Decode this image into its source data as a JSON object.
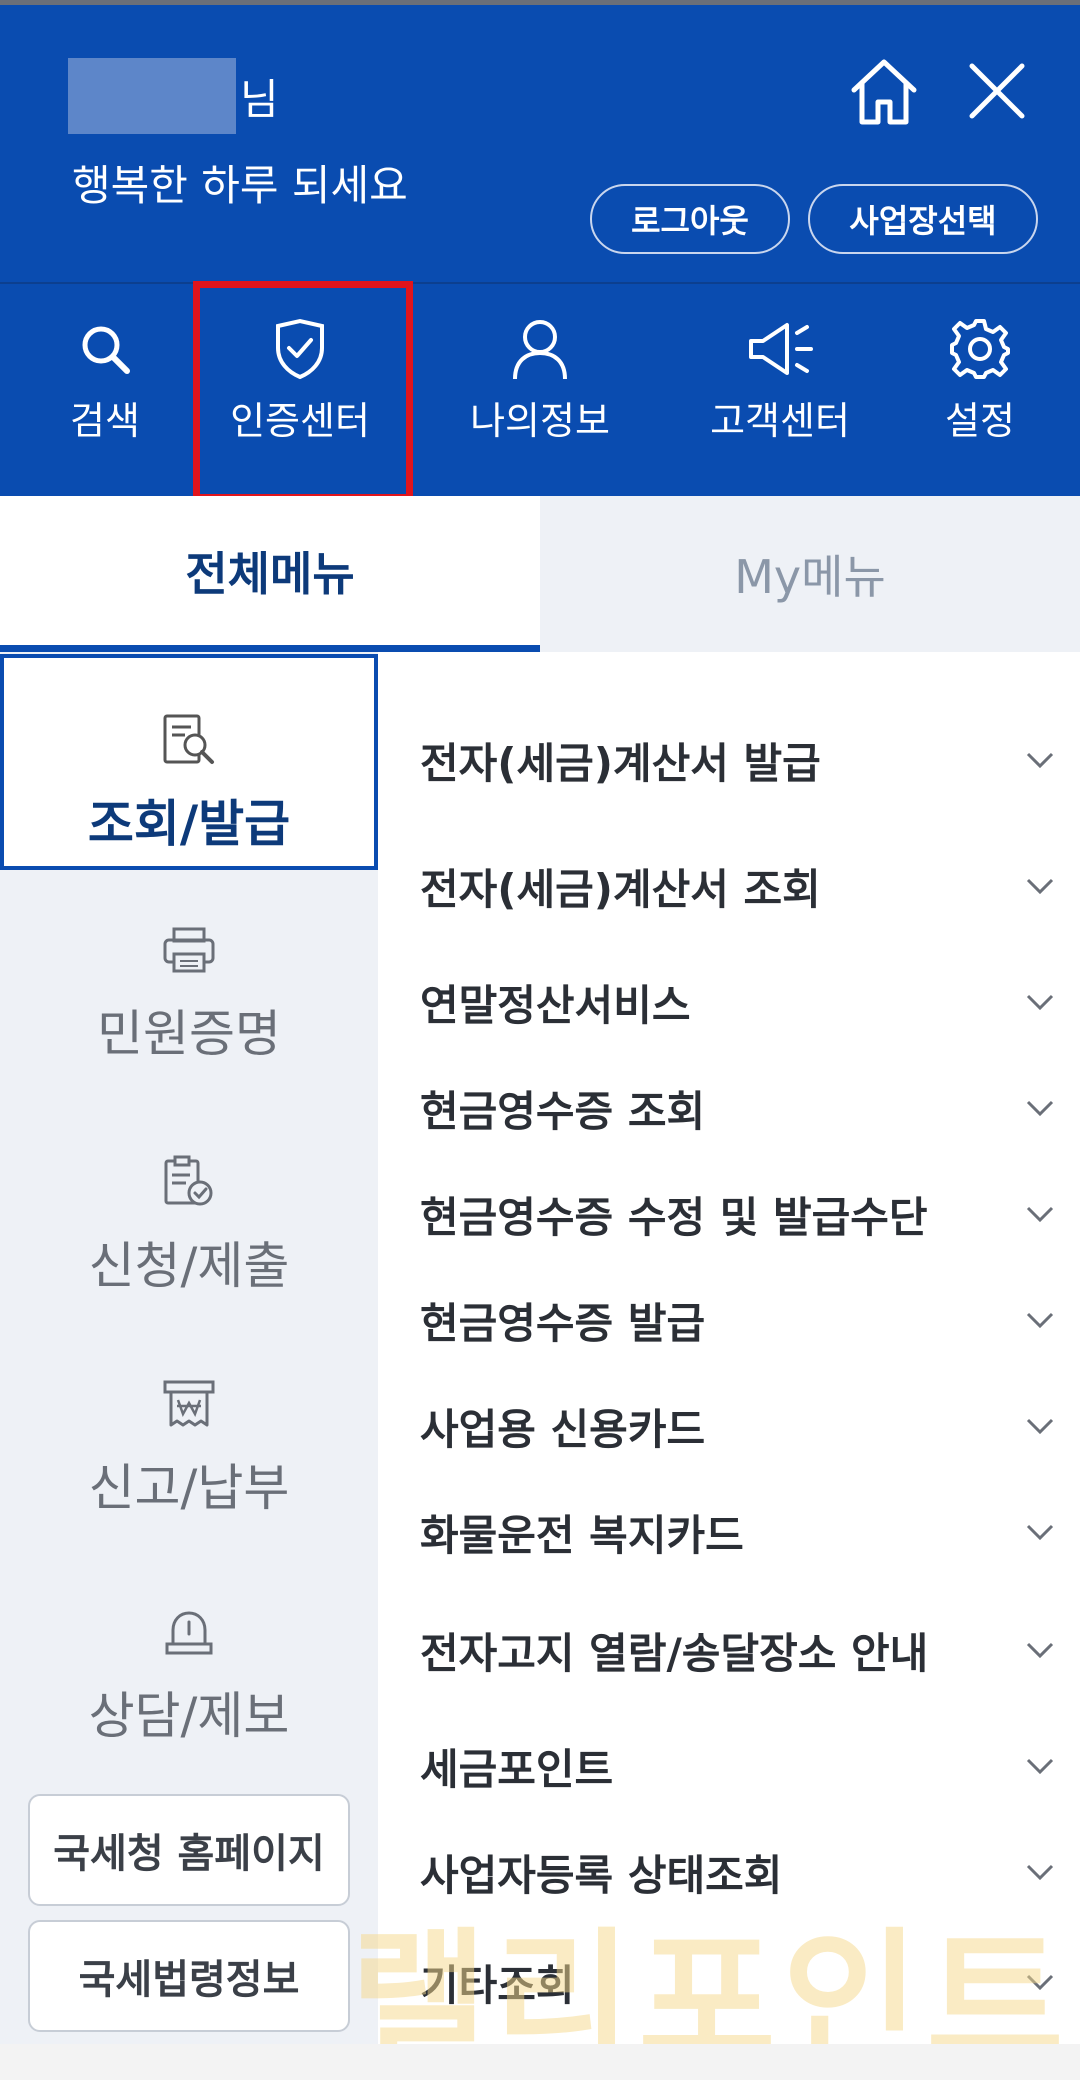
{
  "header": {
    "user_suffix": "님",
    "greeting": "행복한 하루 되세요",
    "logout_label": "로그아웃",
    "business_select_label": "사업장선택"
  },
  "quick_menu": {
    "search": "검색",
    "cert_center": "인증센터",
    "my_info": "나의정보",
    "customer_center": "고객센터",
    "settings": "설정"
  },
  "tabs": {
    "all_menu": "전체메뉴",
    "my_menu": "My메뉴"
  },
  "sidebar": {
    "items": [
      {
        "label": "조회/발급"
      },
      {
        "label": "민원증명"
      },
      {
        "label": "신청/제출"
      },
      {
        "label": "신고/납부"
      },
      {
        "label": "상담/제보"
      }
    ],
    "nts_homepage": "국세청 홈페이지",
    "tax_law_info": "국세법령정보"
  },
  "menu_items": [
    "전자(세금)계산서 발급",
    "전자(세금)계산서 조회",
    "연말정산서비스",
    "현금영수증 조회",
    "현금영수증 수정 및 발급수단",
    "현금영수증 발급",
    "사업용 신용카드",
    "화물운전 복지카드",
    "전자고지 열람/송달장소 안내",
    "세금포인트",
    "사업자등록 상태조회",
    "기타조회"
  ],
  "watermark": "랠리포인트",
  "colors": {
    "brand_blue": "#0a4cb0",
    "highlight_red": "#e1141c"
  }
}
